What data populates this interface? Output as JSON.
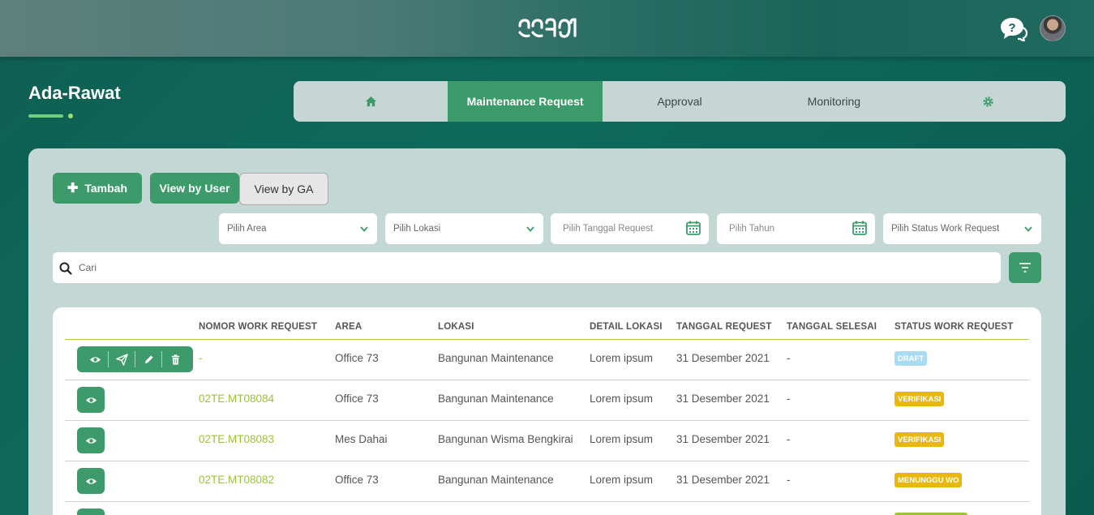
{
  "header": {
    "logo_text": "ഷാഗ്ര",
    "help_icon": "help-chat-icon",
    "avatar": "user-avatar"
  },
  "app": {
    "title": "Ada-Rawat"
  },
  "nav": {
    "home_icon": "home-icon",
    "items": [
      "Maintenance Request",
      "Approval",
      "Monitoring"
    ],
    "settings_icon": "gear-icon"
  },
  "toolbar": {
    "add_label": "Tambah",
    "view_user_label": "View by User",
    "view_ga_label": "View by GA"
  },
  "filters": {
    "area": "Pilih Area",
    "lokasi": "Pilih Lokasi",
    "tanggal": "Pilih Tanggal Request",
    "tahun": "Pilih Tahun",
    "status": "Pilih Status Work Request"
  },
  "search": {
    "placeholder": "Cari"
  },
  "table": {
    "columns": [
      "NOMOR WORK REQUEST",
      "AREA",
      "LOKASI",
      "DETAIL LOKASI",
      "TANGGAL REQUEST",
      "TANGGAL SELESAI",
      "STATUS WORK REQUEST"
    ],
    "rows": [
      {
        "nomor": "-",
        "area": "Office 73",
        "lokasi": "Bangunan Maintenance",
        "detail": "Lorem ipsum",
        "tgl_request": "31 Desember 2021",
        "tgl_selesai": "-",
        "status": "DRAFT",
        "status_color": "#a9dcf3"
      },
      {
        "nomor": "02TE.MT08084",
        "area": "Office 73",
        "lokasi": "Bangunan Maintenance",
        "detail": "Lorem ipsum",
        "tgl_request": "31 Desember 2021",
        "tgl_selesai": "-",
        "status": "VERIFIKASI",
        "status_color": "#e9b80f"
      },
      {
        "nomor": "02TE.MT08083",
        "area": "Mes Dahai",
        "lokasi": "Bangunan Wisma Bengkirai",
        "detail": "Lorem ipsum",
        "tgl_request": "31 Desember 2021",
        "tgl_selesai": "-",
        "status": "VERIFIKASI",
        "status_color": "#e9b80f"
      },
      {
        "nomor": "02TE.MT08082",
        "area": "Office 73",
        "lokasi": "Bangunan Maintenance",
        "detail": "Lorem ipsum",
        "tgl_request": "31 Desember 2021",
        "tgl_selesai": "-",
        "status": "MENUNGGU WO",
        "status_color": "#e9b80f"
      }
    ]
  },
  "colors": {
    "accent": "#3d9b6b",
    "link": "#9cc23a",
    "panel": "#c3d7d4"
  }
}
